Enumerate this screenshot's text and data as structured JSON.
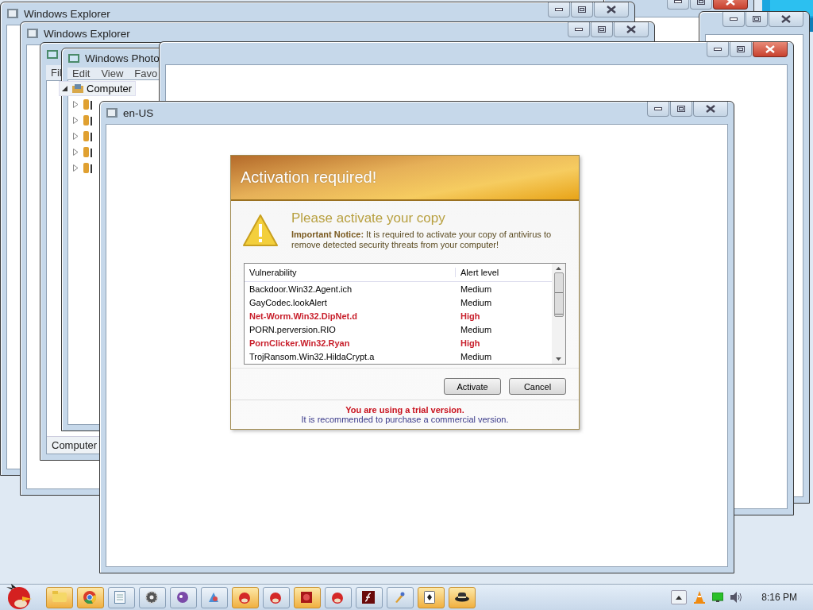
{
  "windows": [
    {
      "focused": true
    },
    {
      "focused": false
    },
    {
      "title": "Windows Explorer",
      "focused": false
    },
    {
      "title": "Windows Explorer",
      "focused": false
    },
    {
      "kind": "explorer",
      "menu": [
        "Fil"
      ],
      "status": "Computer"
    },
    {
      "kind": "explorer",
      "title": "Windows Photo",
      "menu": [
        "Edit",
        "View",
        "Favo"
      ],
      "tree": {
        "label": "Computer",
        "expanded": true,
        "children": [
          {
            "expanded": false
          },
          {
            "expanded": false
          },
          {
            "expanded": false
          },
          {
            "expanded": false
          },
          {
            "expanded": false
          }
        ]
      }
    },
    {
      "focused": true
    },
    {
      "title": "en-US",
      "focused": false
    }
  ],
  "dialog": {
    "title": "Activation required!",
    "heading": "Please activate your copy",
    "notice": "**Important Notice:** It is required to activate your copy of antivirus to remove detected security threats from your computer!",
    "columns": [
      "Vulnerability",
      "Alert level"
    ],
    "rows": [
      {
        "name": "Backdoor.Win32.Agent.ich",
        "level": "Medium",
        "highlighted": false
      },
      {
        "name": "GayCodec.lookAlert",
        "level": "Medium",
        "highlighted": false
      },
      {
        "name": "Net-Worm.Win32.DipNet.d",
        "level": "High",
        "highlighted": true
      },
      {
        "name": "PORN.perversion.RIO",
        "level": "Medium",
        "highlighted": false
      },
      {
        "name": "PornClicker.Win32.Ryan",
        "level": "High",
        "highlighted": true
      },
      {
        "name": "TrojRansom.Win32.HildaCrypt.a",
        "level": "Medium",
        "highlighted": false
      }
    ],
    "buttons": [
      "Activate",
      "Cancel"
    ],
    "warning": "You are using a trial version.",
    "note": "It is recommended to purchase a commercial version."
  },
  "taskbar": {
    "items": [
      {
        "highlighted": true
      },
      {
        "highlighted": true
      },
      {
        "highlighted": false
      },
      {
        "highlighted": false
      },
      {
        "highlighted": false
      },
      {
        "highlighted": false
      },
      {
        "highlighted": true
      },
      {
        "highlighted": false
      },
      {
        "highlighted": true
      },
      {
        "highlighted": false
      },
      {
        "highlighted": false
      },
      {
        "highlighted": false
      },
      {
        "highlighted": true
      },
      {
        "highlighted": true
      }
    ],
    "clock": "8:16 PM"
  }
}
